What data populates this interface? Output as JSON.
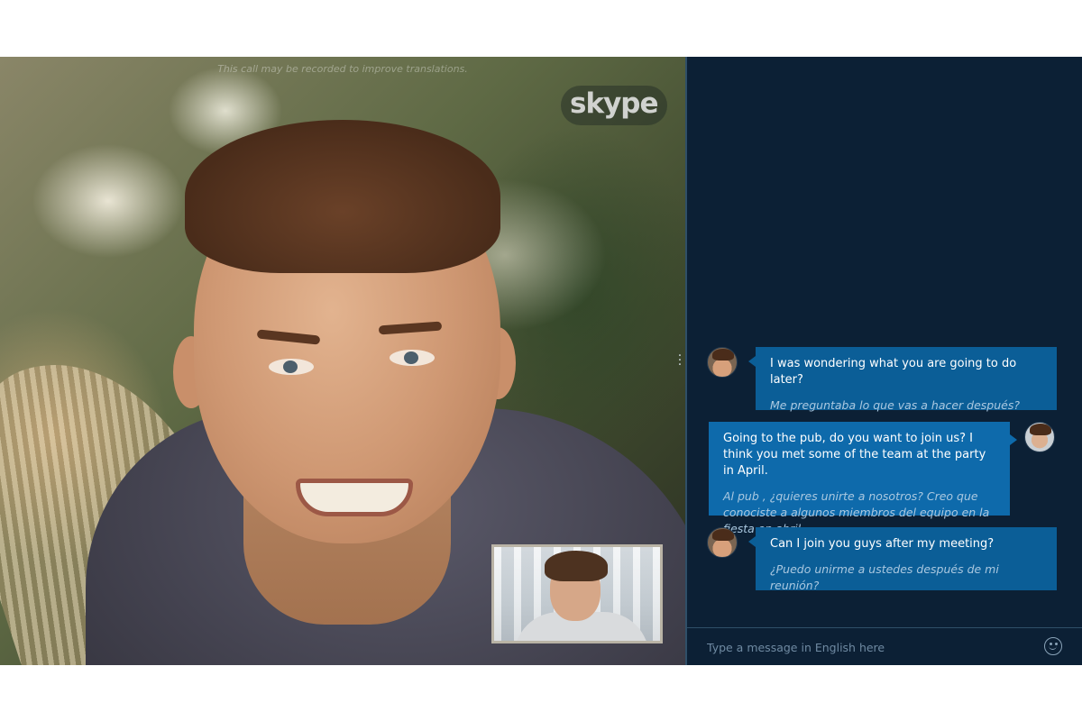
{
  "call": {
    "notice": "This call may be recorded to improve translations.",
    "logo_text": "skype"
  },
  "chat": {
    "messages": [
      {
        "direction": "received",
        "original": "I was wondering what you are going to do later?",
        "translation": "Me preguntaba lo que vas a hacer después?"
      },
      {
        "direction": "sent",
        "original": "Going to the pub, do you want to join us? I think you met some of the team at the party in April.",
        "translation": "Al pub , ¿quieres unirte a nosotros? Creo que conociste a algunos miembros del equipo en la fiesta en abril ."
      },
      {
        "direction": "received",
        "original": "Can I join you guys after my meeting?",
        "translation": "¿Puedo unirme a ustedes después de mi reunión?"
      }
    ],
    "input": {
      "placeholder": "Type a message in English here",
      "value": ""
    }
  },
  "icons": {
    "emoticon": "smiley-icon",
    "divider": "more-vertical-icon"
  },
  "colors": {
    "panel_bg": "#0c2035",
    "bubble_bg": "#0b5e97",
    "translation_text": "#aac8e0"
  }
}
